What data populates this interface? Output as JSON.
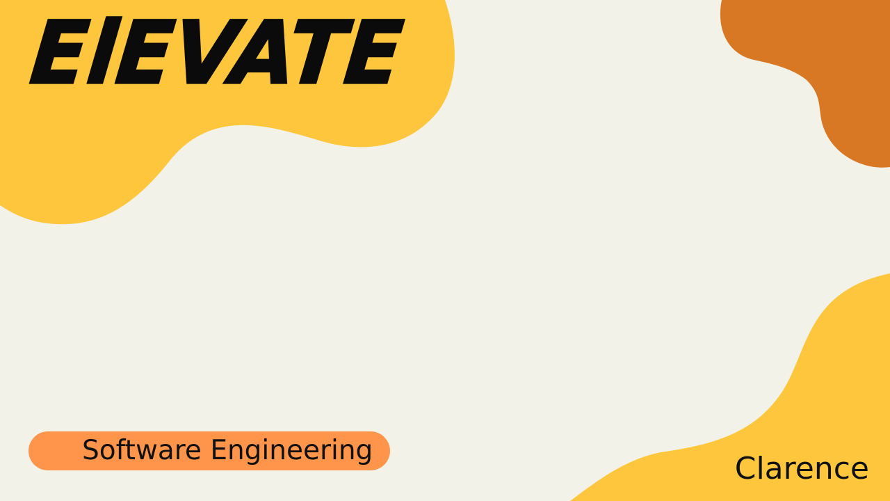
{
  "slide": {
    "title": "ElEVATE",
    "subtitle": "Software Engineering",
    "author": "Clarence"
  },
  "colors": {
    "background": "#f3f2e8",
    "yellow_blob": "#fdc63d",
    "orange_blob": "#d97824",
    "pill": "#ff954a",
    "text": "#0b0b0b"
  }
}
